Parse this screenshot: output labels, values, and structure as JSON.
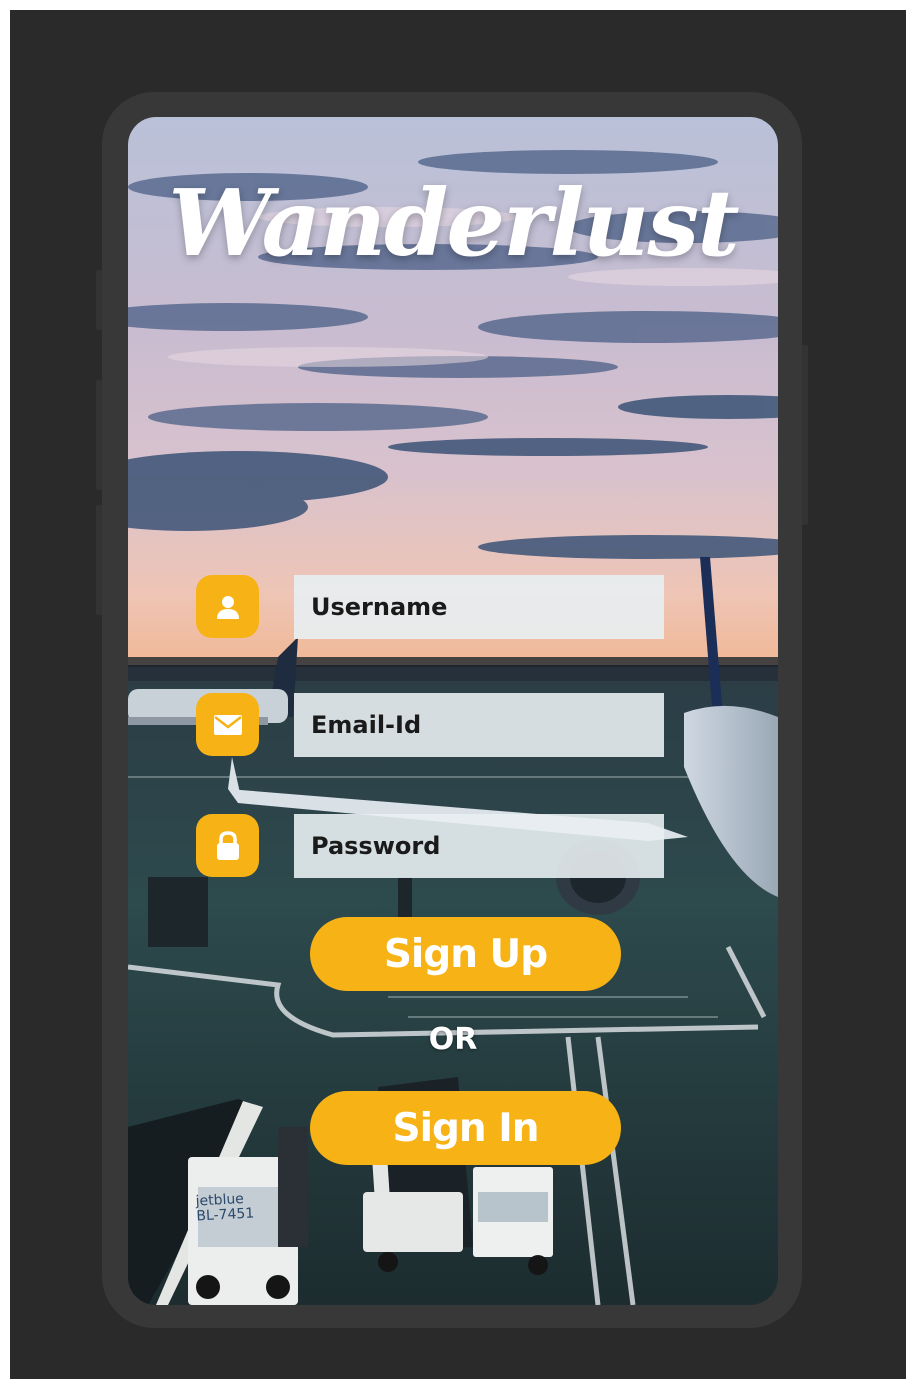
{
  "app": {
    "title": "Wanderlust"
  },
  "form": {
    "username_placeholder": "Username",
    "email_placeholder": "Email-Id",
    "password_placeholder": "Password"
  },
  "actions": {
    "sign_up_label": "Sign Up",
    "separator": "OR",
    "sign_in_label": "Sign In"
  },
  "background": {
    "vehicle_brand": "jetblue",
    "vehicle_id": "BL-7451"
  },
  "icons": {
    "username": "user-icon",
    "email": "envelope-icon",
    "password": "lock-icon"
  },
  "colors": {
    "accent": "#f7b216",
    "field_bg": "#e8eef2",
    "text_dark": "#1a1a1a",
    "frame": "#383838",
    "backdrop": "#2a2a2a"
  }
}
